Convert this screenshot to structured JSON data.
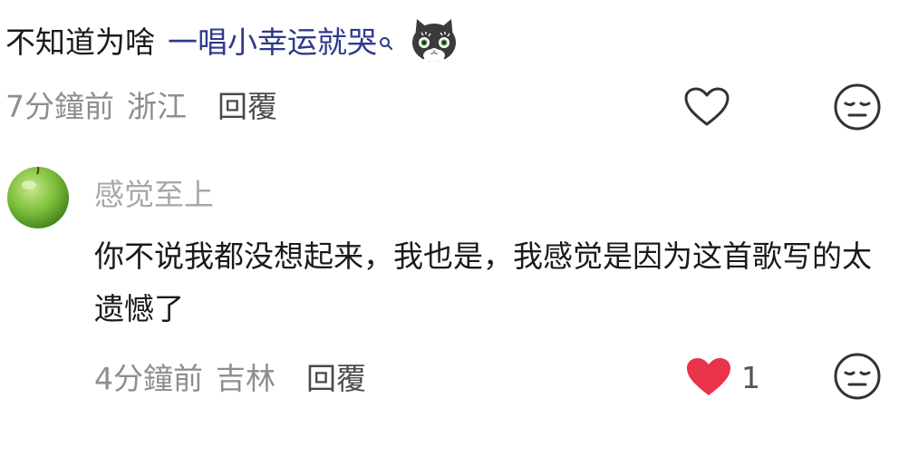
{
  "comments": [
    {
      "text_plain": "不知道为啥",
      "hashtag": "一唱小幸运就哭",
      "emoji": "cat-emoji",
      "time": "7分鐘前",
      "location": "浙江",
      "reply_label": "回覆",
      "liked": false
    },
    {
      "username": "感觉至上",
      "text": "你不说我都没想起来，我也是，我感觉是因为这首歌写的太遗憾了",
      "time": "4分鐘前",
      "location": "吉林",
      "reply_label": "回覆",
      "liked": true,
      "like_count": "1"
    }
  ],
  "colors": {
    "hashtag": "#2d3a8c",
    "meta": "#8e8e8e",
    "username": "#a8a8a8",
    "like_active": "#e8334a",
    "icon_stroke": "#333333"
  }
}
